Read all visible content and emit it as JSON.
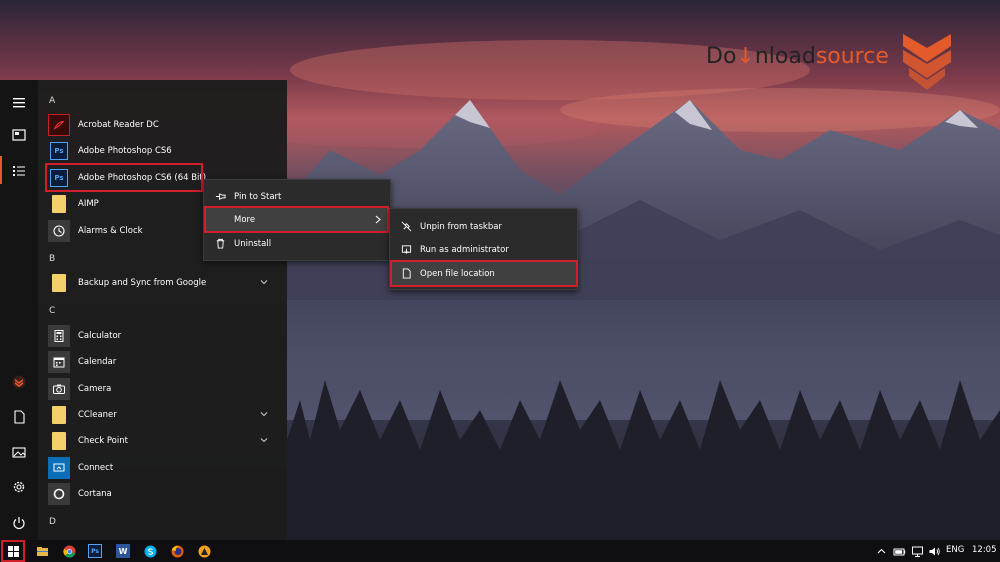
{
  "watermark": {
    "prefix": "Do",
    "accent": "↓",
    "middle": "nload",
    "suffix": "source"
  },
  "colors": {
    "accent": "#e35b2b",
    "highlight": "#d01e2a",
    "menu_bg": "#2b2b2b",
    "start_bg": "#1c1c1c",
    "taskbar_bg": "#0f0f12"
  },
  "start_menu": {
    "rail": [
      {
        "icon": "hamburger-menu-icon"
      },
      {
        "icon": "tiles-icon"
      },
      {
        "icon": "all-apps-list-icon"
      },
      {
        "icon": "user-avatar-icon"
      },
      {
        "icon": "documents-icon"
      },
      {
        "icon": "pictures-icon"
      },
      {
        "icon": "settings-gear-icon"
      },
      {
        "icon": "power-icon"
      }
    ],
    "sections": {
      "a": "A",
      "b": "B",
      "c": "C",
      "d": "D"
    },
    "apps": {
      "acrobat": "Acrobat Reader DC",
      "photoshop": "Adobe Photoshop CS6",
      "photoshop64": "Adobe Photoshop CS6 (64 Bit)",
      "aimp": "AIMP",
      "alarms": "Alarms & Clock",
      "backup": "Backup and Sync from Google",
      "calculator": "Calculator",
      "calendar": "Calendar",
      "camera": "Camera",
      "ccleaner": "CCleaner",
      "checkpoint": "Check Point",
      "connect": "Connect",
      "cortana": "Cortana"
    },
    "tile_labels": {
      "ps": "Ps"
    }
  },
  "context_menu": {
    "pin_to_start": "Pin to Start",
    "more": "More",
    "uninstall": "Uninstall"
  },
  "submenu": {
    "unpin_taskbar": "Unpin from taskbar",
    "run_as_admin": "Run as administrator",
    "open_file_location": "Open file location"
  },
  "taskbar": {
    "tb_ps": "Ps",
    "tb_word": "W",
    "language": "ENG",
    "clock": "12:05"
  }
}
